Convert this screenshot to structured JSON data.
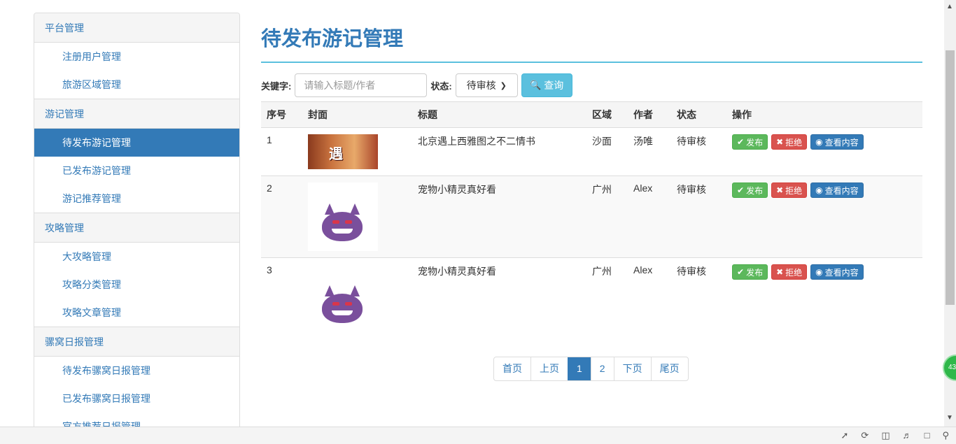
{
  "sidebar": {
    "groups": [
      {
        "title": "平台管理",
        "items": [
          "注册用户管理",
          "旅游区域管理"
        ]
      },
      {
        "title": "游记管理",
        "items": [
          "待发布游记管理",
          "已发布游记管理",
          "游记推荐管理"
        ]
      },
      {
        "title": "攻略管理",
        "items": [
          "大攻略管理",
          "攻略分类管理",
          "攻略文章管理"
        ]
      },
      {
        "title": "骡窝日报管理",
        "items": [
          "待发布骡窝日报管理",
          "已发布骡窝日报管理",
          "官方推荐日报管理"
        ]
      }
    ],
    "active_item": "待发布游记管理"
  },
  "main": {
    "title": "待发布游记管理",
    "filter": {
      "keyword_label": "关键字:",
      "keyword_placeholder": "请输入标题/作者",
      "status_label": "状态:",
      "status_value": "待审核",
      "query_button": "查询"
    },
    "table": {
      "headers": [
        "序号",
        "封面",
        "标题",
        "区域",
        "作者",
        "状态",
        "操作"
      ],
      "rows": [
        {
          "index": "1",
          "title": "北京遇上西雅图之不二情书",
          "region": "沙面",
          "author": "汤唯",
          "status": "待审核",
          "cover_text": "遇"
        },
        {
          "index": "2",
          "title": "宠物小精灵真好看",
          "region": "广州",
          "author": "Alex",
          "status": "待审核"
        },
        {
          "index": "3",
          "title": "宠物小精灵真好看",
          "region": "广州",
          "author": "Alex",
          "status": "待审核"
        }
      ],
      "actions": {
        "publish": "发布",
        "reject": "拒绝",
        "view": "查看内容"
      }
    },
    "pagination": {
      "first": "首页",
      "prev": "上页",
      "pages": [
        "1",
        "2"
      ],
      "current": "1",
      "next": "下页",
      "last": "尾页"
    }
  },
  "floating_badge": "43",
  "colors": {
    "primary": "#337ab7",
    "info": "#5bc0de",
    "success": "#5cb85c",
    "danger": "#d9534f"
  }
}
